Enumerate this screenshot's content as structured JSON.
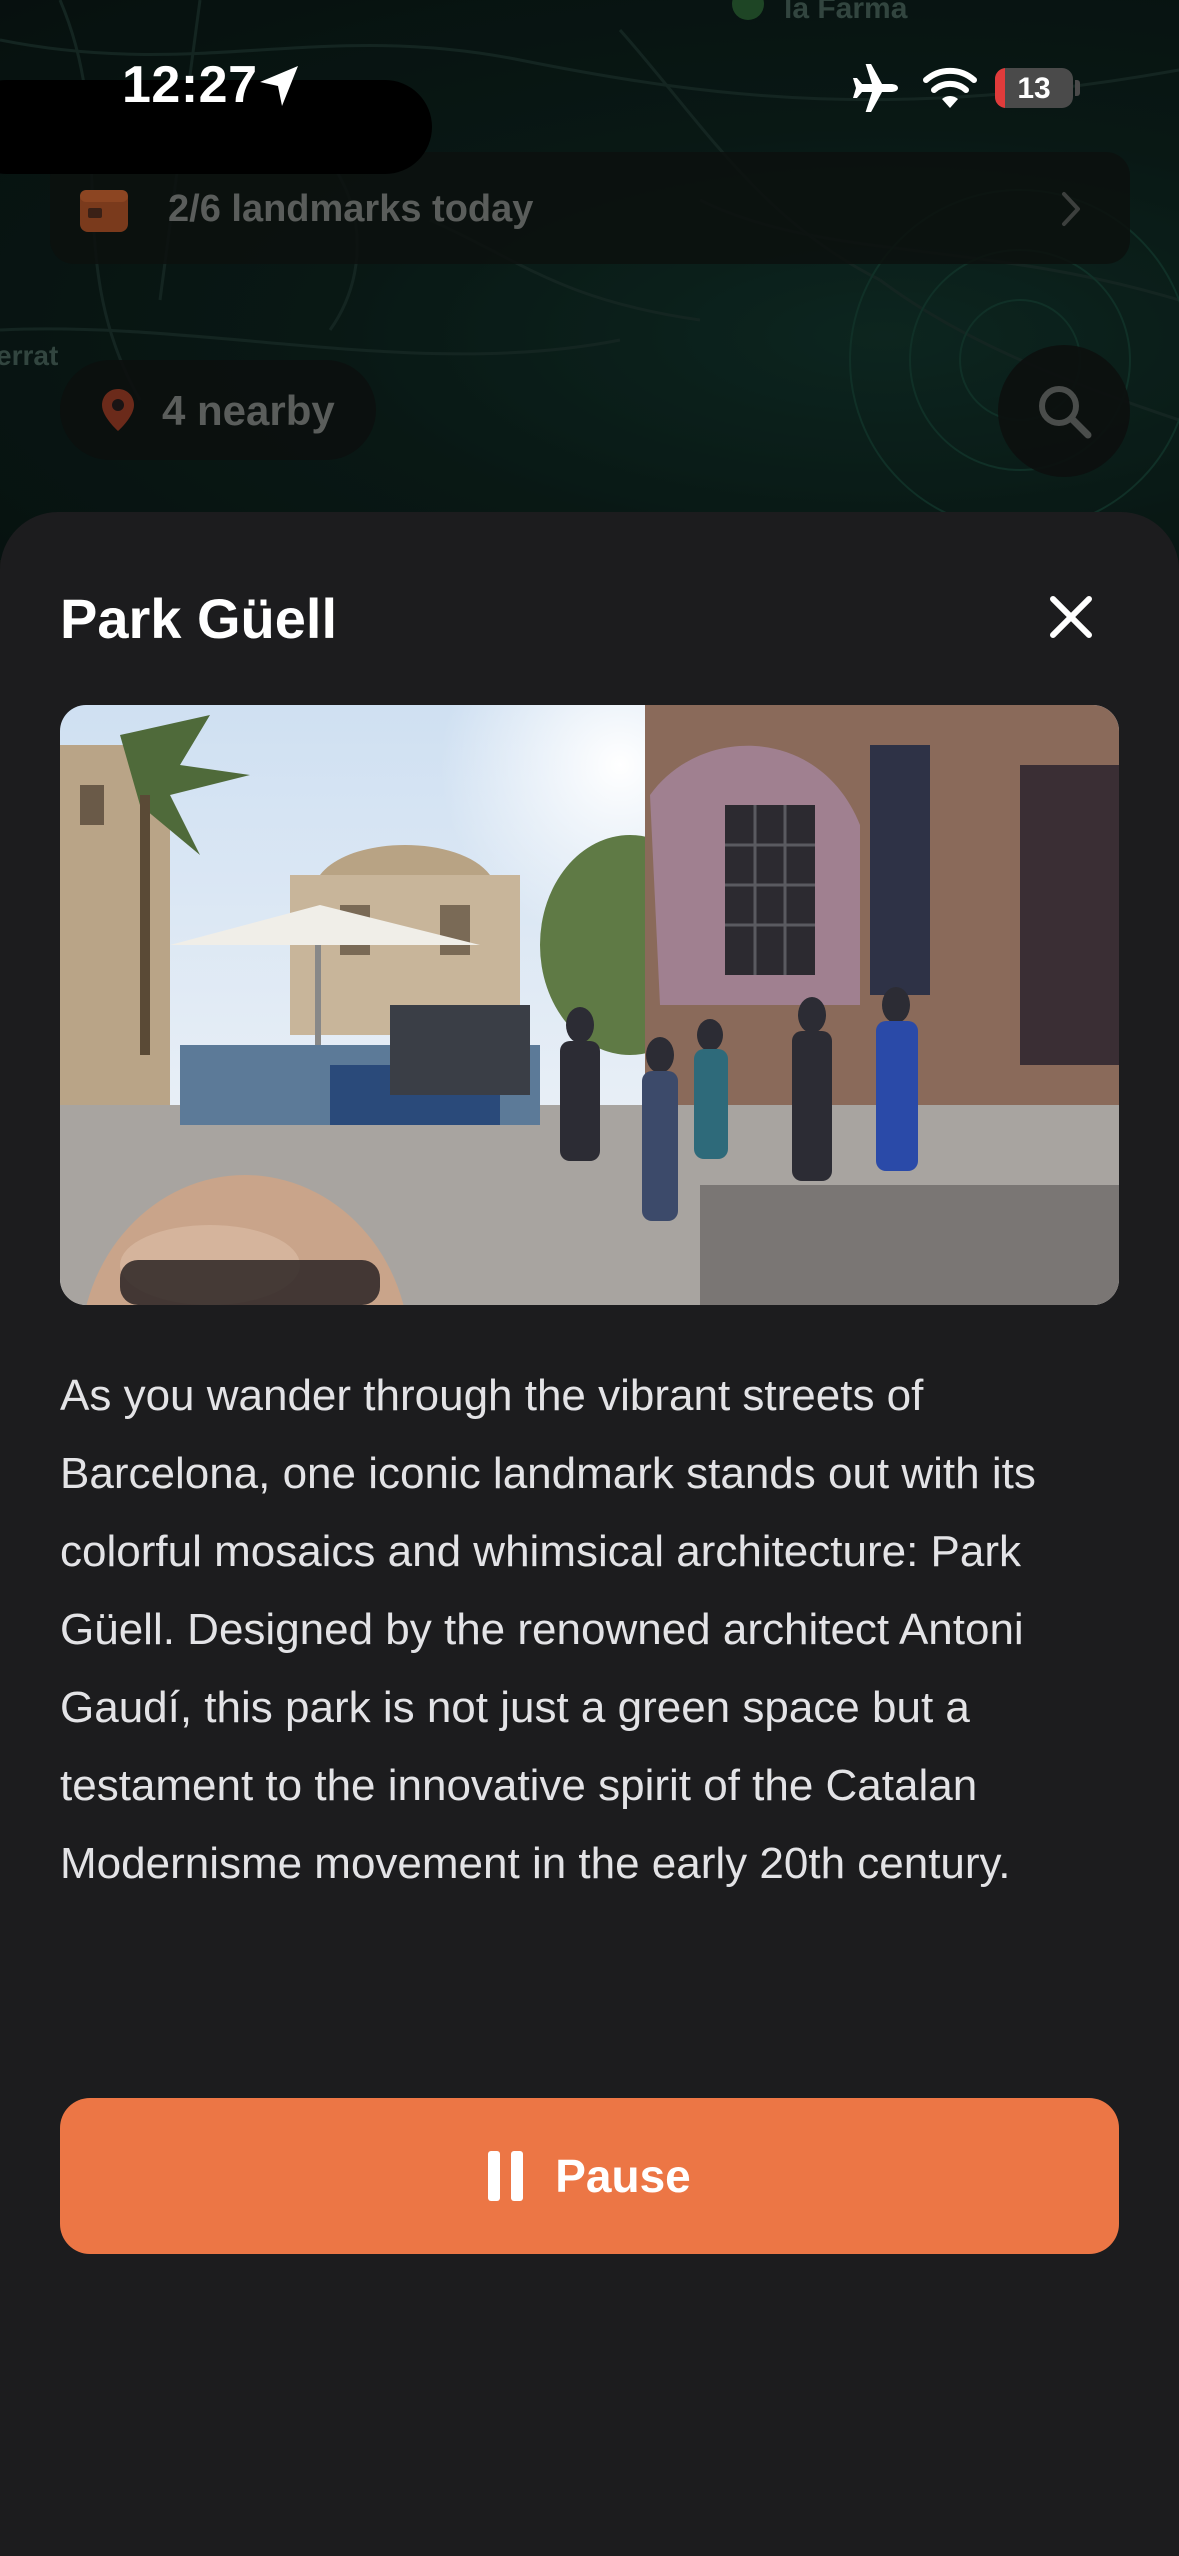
{
  "status_bar": {
    "time": "12:27",
    "battery_level": "13",
    "battery_fraction": 0.13,
    "icons": [
      "location-arrow-icon",
      "airplane-icon",
      "wifi-icon",
      "battery-icon"
    ]
  },
  "map": {
    "labels": [
      "la Farma",
      "errat"
    ],
    "progress_banner": {
      "text": "2/6 landmarks today",
      "icon": "calendar-icon"
    },
    "nearby_chip": {
      "text": "4 nearby",
      "icon": "map-pin-icon"
    },
    "search_icon": "search-icon"
  },
  "sheet": {
    "title": "Park Güell",
    "close_icon": "close-icon",
    "description": "As you wander through the vibrant streets of Barcelona, one iconic landmark stands out with its colorful mosaics and whimsical architecture: Park Güell. Designed by the renowned architect Antoni Gaudí, this park is not just a green space but a testament to the innovative spirit of the Catalan Modernisme movement in the early 20th century.",
    "pause_button": {
      "label": "Pause",
      "icon": "pause-icon"
    }
  },
  "colors": {
    "accent": "#ec7645",
    "sheet_bg": "#1c1c1e",
    "text_primary": "#ffffff",
    "text_body": "#e3e3e6"
  }
}
